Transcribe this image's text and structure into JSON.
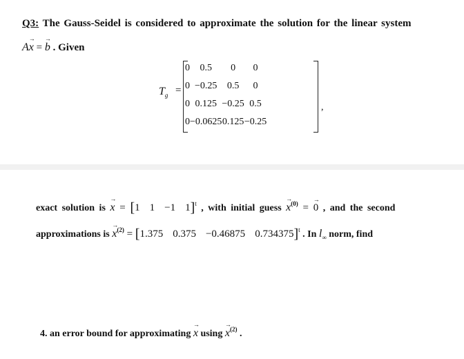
{
  "question": {
    "label": "Q3:",
    "intro": " The Gauss-Seidel is considered to approximate the solution for the linear system",
    "system_A": "A",
    "system_x": "x",
    "system_eq": " = ",
    "system_b": "b",
    "given": " . Given"
  },
  "matrix": {
    "name": "T",
    "subscript": "g",
    "equals": "=",
    "trailing": ",",
    "rows": [
      [
        "0",
        "0.5",
        "0",
        "0"
      ],
      [
        "0",
        "−0.25",
        "0.5",
        "0"
      ],
      [
        "0",
        "0.125",
        "−0.25",
        "0.5"
      ],
      [
        "0",
        "−0.0625",
        "0.125",
        "−0.25"
      ]
    ]
  },
  "exact": {
    "prefix": "exact solution is ",
    "var": "x",
    "eq": " = ",
    "values": [
      "1",
      "1",
      "−1",
      "1"
    ],
    "transpose": "t",
    "mid": " , with initial guess ",
    "init_var": "x",
    "init_sup": "(0)",
    "init_eq": " = ",
    "init_val": "0",
    "suffix": " , and the second"
  },
  "approx": {
    "prefix": "approximations is ",
    "var": "x",
    "sup": "(2)",
    "eq": " = ",
    "values": [
      "1.375",
      "0.375",
      "−0.46875",
      "0.734375"
    ],
    "transpose": "t",
    "mid": " . In ",
    "norm": "l",
    "norm_sub": "∞",
    "suffix": " norm, find"
  },
  "task": {
    "number": "4.",
    "text": " an error bound for approximating ",
    "var": "x",
    "using": " using ",
    "var2": "x",
    "sup": "(2)",
    "end": " ."
  }
}
